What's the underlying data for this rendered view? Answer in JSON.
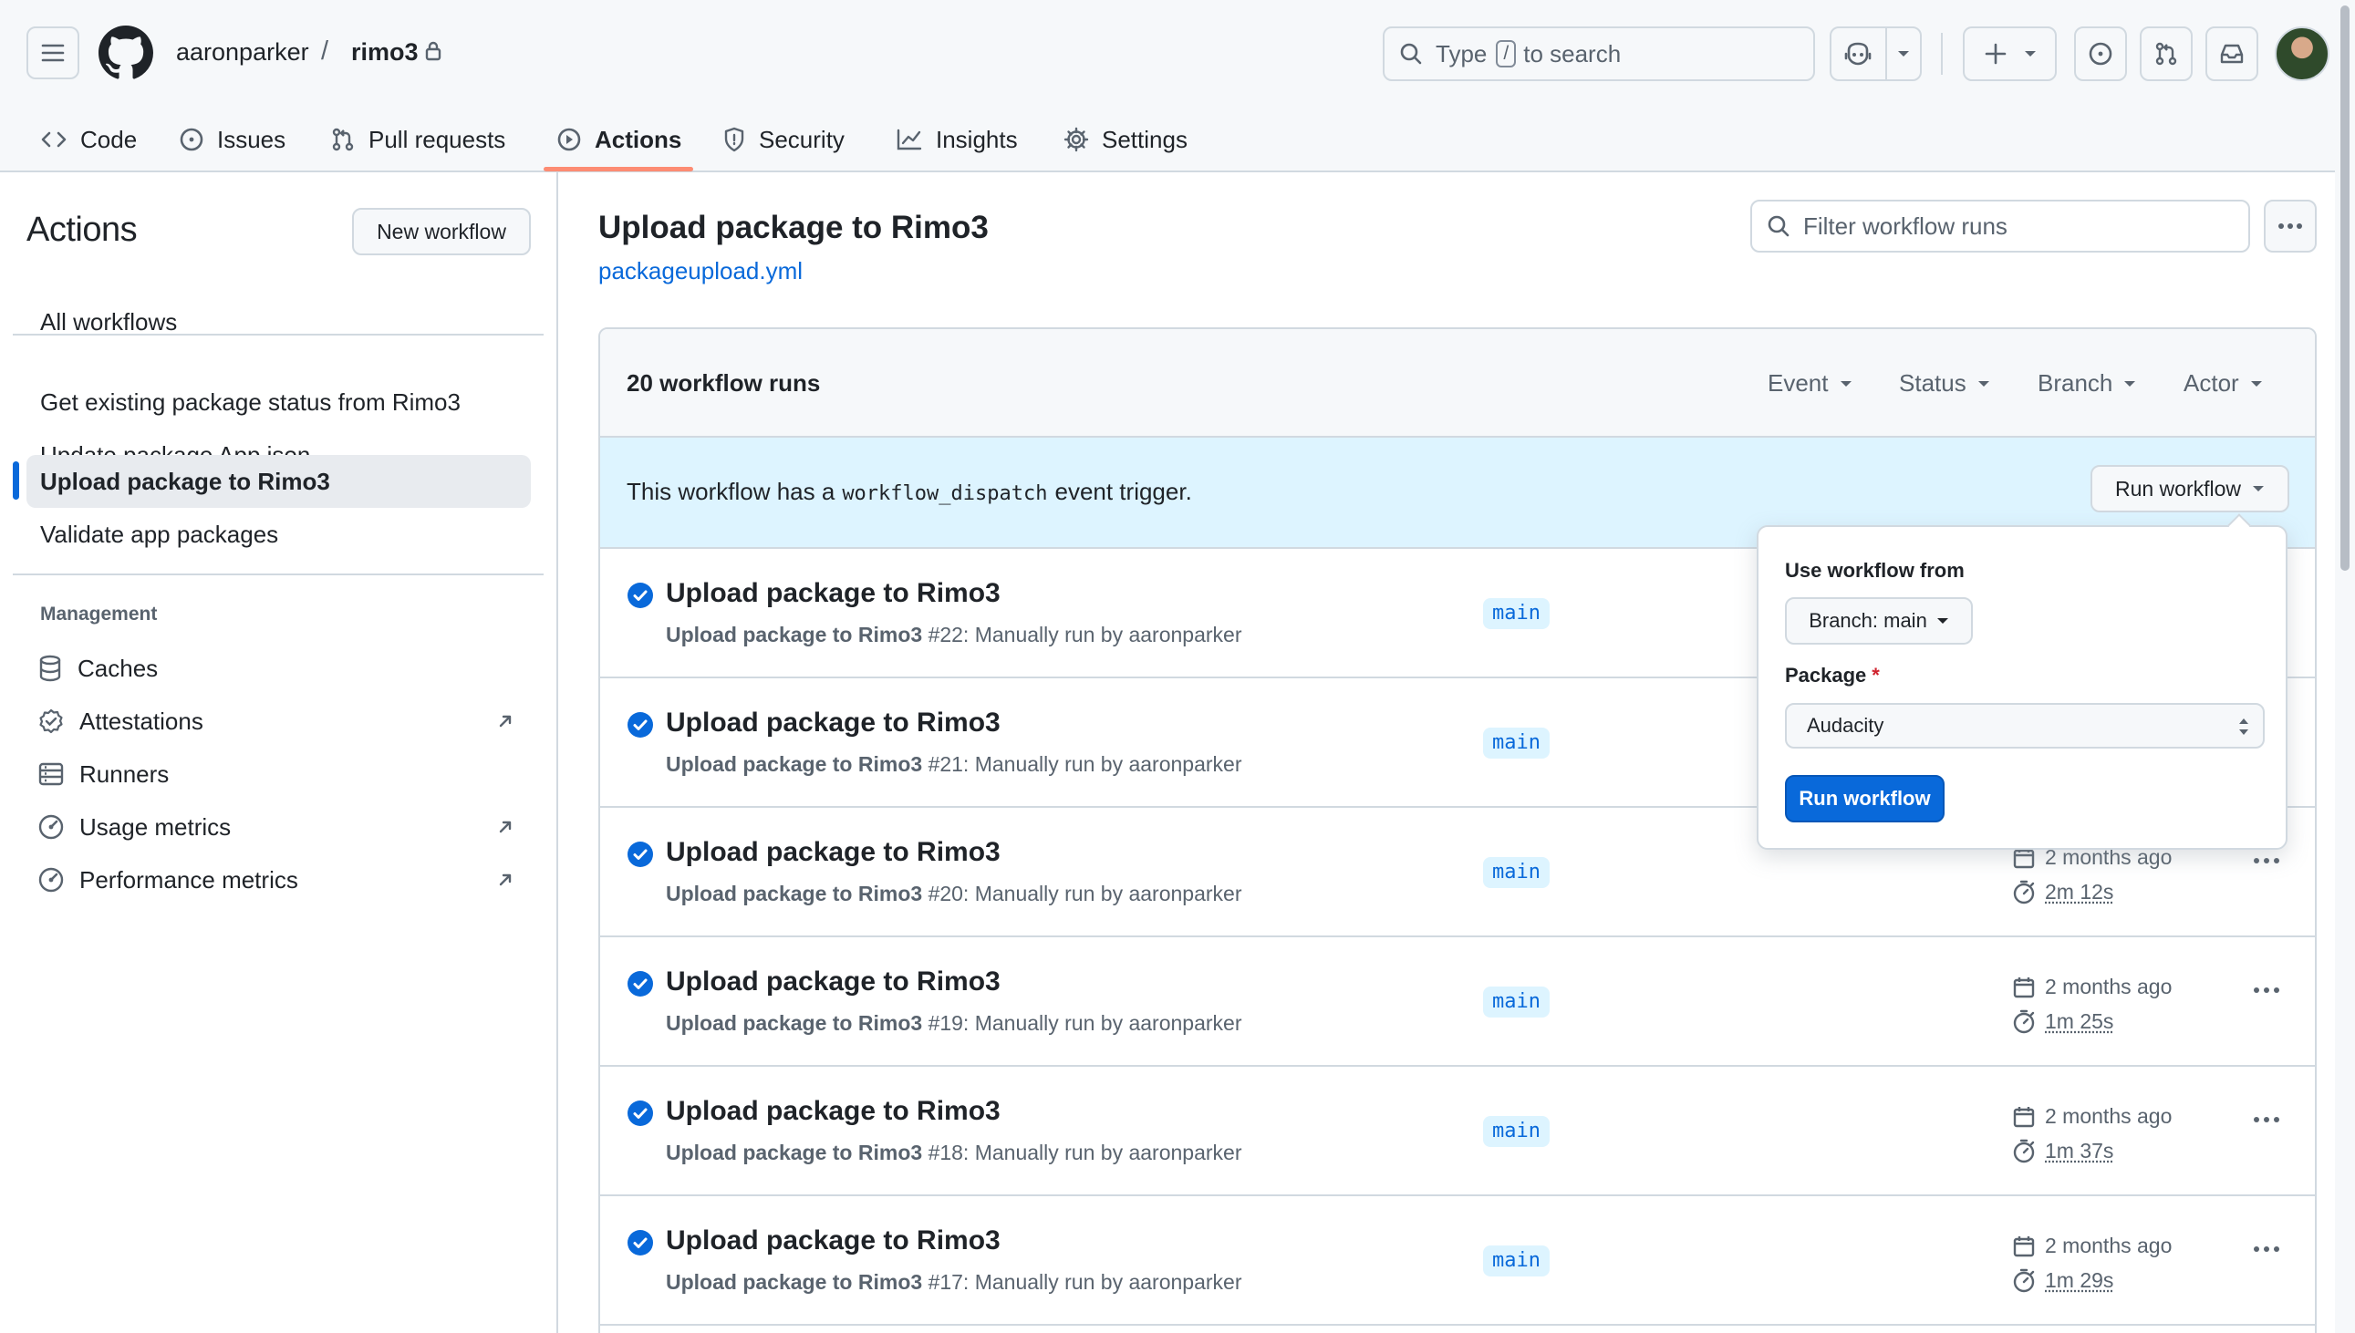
{
  "header": {
    "owner": "aaronparker",
    "separator": "/",
    "repo": "rimo3",
    "search": {
      "type_label": "Type",
      "key": "/",
      "suffix": "to search"
    }
  },
  "repo_nav": {
    "tabs": [
      {
        "label": "Code",
        "icon": "code-icon"
      },
      {
        "label": "Issues",
        "icon": "issue-opened-icon"
      },
      {
        "label": "Pull requests",
        "icon": "git-pull-request-icon"
      },
      {
        "label": "Actions",
        "icon": "play-icon",
        "active": true
      },
      {
        "label": "Security",
        "icon": "shield-icon"
      },
      {
        "label": "Insights",
        "icon": "graph-icon"
      },
      {
        "label": "Settings",
        "icon": "gear-icon"
      }
    ]
  },
  "sidebar": {
    "title": "Actions",
    "new_workflow_label": "New workflow",
    "all_workflows": "All workflows",
    "workflows": [
      "Get existing package status from Rimo3",
      "Update package App.json",
      "Upload package to Rimo3",
      "Validate app packages"
    ],
    "active_workflow": "Upload package to Rimo3",
    "management_title": "Management",
    "management": [
      {
        "label": "Caches",
        "icon": "database-icon",
        "external": false
      },
      {
        "label": "Attestations",
        "icon": "verified-icon",
        "external": true
      },
      {
        "label": "Runners",
        "icon": "server-icon",
        "external": false
      },
      {
        "label": "Usage metrics",
        "icon": "meter-icon",
        "external": true
      },
      {
        "label": "Performance metrics",
        "icon": "meter-icon",
        "external": true
      }
    ]
  },
  "main": {
    "title": "Upload package to Rimo3",
    "file": "packageupload.yml",
    "filter_placeholder": "Filter workflow runs",
    "runs_count": "20 workflow runs",
    "filters": [
      "Event",
      "Status",
      "Branch",
      "Actor"
    ],
    "dispatch": {
      "prefix": "This workflow has a",
      "code": "workflow_dispatch",
      "suffix": "event trigger.",
      "button_label": "Run workflow"
    },
    "runs": [
      {
        "title": "Upload package to Rimo3",
        "name": "Upload package to Rimo3",
        "detail": "#22: Manually run by aaronparker",
        "branch": "main",
        "when": "",
        "duration": ""
      },
      {
        "title": "Upload package to Rimo3",
        "name": "Upload package to Rimo3",
        "detail": "#21: Manually run by aaronparker",
        "branch": "main",
        "when": "",
        "duration": ""
      },
      {
        "title": "Upload package to Rimo3",
        "name": "Upload package to Rimo3",
        "detail": "#20: Manually run by aaronparker",
        "branch": "main",
        "when": "2 months ago",
        "duration": "2m 12s"
      },
      {
        "title": "Upload package to Rimo3",
        "name": "Upload package to Rimo3",
        "detail": "#19: Manually run by aaronparker",
        "branch": "main",
        "when": "2 months ago",
        "duration": "1m 25s"
      },
      {
        "title": "Upload package to Rimo3",
        "name": "Upload package to Rimo3",
        "detail": "#18: Manually run by aaronparker",
        "branch": "main",
        "when": "2 months ago",
        "duration": "1m 37s"
      },
      {
        "title": "Upload package to Rimo3",
        "name": "Upload package to Rimo3",
        "detail": "#17: Manually run by aaronparker",
        "branch": "main",
        "when": "2 months ago",
        "duration": "1m 29s"
      }
    ]
  },
  "popover": {
    "use_from_label": "Use workflow from",
    "branch_label": "Branch: main",
    "package_label": "Package",
    "required_mark": "*",
    "package_value": "Audacity",
    "submit_label": "Run workflow"
  },
  "colors": {
    "accent": "#0969da",
    "tab_underline": "#fd8c73",
    "success": "#0969da",
    "dispatch_bg": "#ddf4ff",
    "required": "#cf222e"
  }
}
